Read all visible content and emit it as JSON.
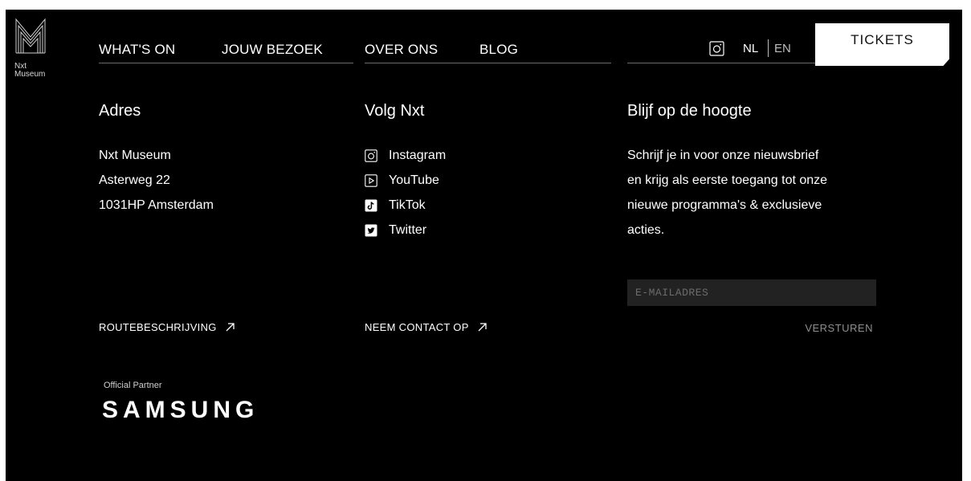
{
  "brand": {
    "line1": "Nxt",
    "line2": "Museum"
  },
  "nav": {
    "items": [
      {
        "label": "WHAT'S ON"
      },
      {
        "label": "JOUW BEZOEK"
      },
      {
        "label": "OVER ONS"
      },
      {
        "label": "BLOG"
      }
    ],
    "lang_active": "NL",
    "lang_other": "EN",
    "tickets_label": "TICKETS",
    "icon": "instagram-icon"
  },
  "address": {
    "heading": "Adres",
    "lines": [
      "Nxt Museum",
      "Asterweg 22",
      "1031HP Amsterdam"
    ],
    "link_label": "ROUTEBESCHRIJVING"
  },
  "social": {
    "heading": "Volg Nxt",
    "items": [
      {
        "label": "Instagram",
        "icon": "instagram-icon"
      },
      {
        "label": "YouTube",
        "icon": "youtube-icon"
      },
      {
        "label": "TikTok",
        "icon": "tiktok-icon"
      },
      {
        "label": "Twitter",
        "icon": "twitter-icon"
      }
    ],
    "link_label": "NEEM CONTACT OP"
  },
  "newsletter": {
    "heading": "Blijf op de hoogte",
    "lines": [
      "Schrijf je in voor onze nieuwsbrief",
      "en krijg als eerste toegang tot onze",
      "nieuwe programma's & exclusieve",
      "acties."
    ],
    "email_placeholder": "E-MAILADRES",
    "email_value": "",
    "submit_label": "VERSTUREN"
  },
  "partner": {
    "label": "Official Partner",
    "logo_text": "SAMSUNG"
  },
  "colors": {
    "background": "#000000",
    "text": "#ffffff",
    "muted": "#8f8f8f",
    "input_bg": "#222222",
    "button_bg": "#ffffff"
  }
}
